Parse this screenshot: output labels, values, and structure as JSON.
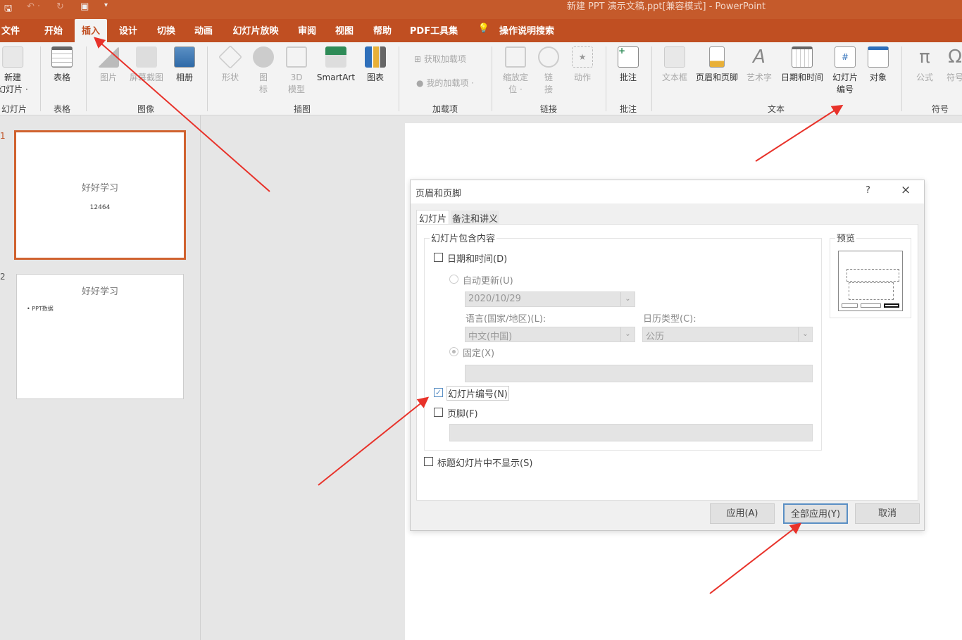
{
  "window": {
    "title": "新建 PPT 演示文稿.ppt[兼容模式]  -  PowerPoint"
  },
  "tabs": [
    "文件",
    "开始",
    "插入",
    "设计",
    "切换",
    "动画",
    "幻灯片放映",
    "审阅",
    "视图",
    "帮助",
    "PDF工具集"
  ],
  "active_tab": "插入",
  "search": "操作说明搜索",
  "ribbon": {
    "items": {
      "new_slide": "新建\n幻灯片 ·",
      "table": "表格",
      "picture": "图片",
      "screenshot": "屏幕截图",
      "album": "相册",
      "shapes": "形状",
      "icons": "图\n标",
      "model3d": "3D\n模型",
      "smartart": "SmartArt",
      "chart": "图表",
      "get_addins": "获取加载项",
      "my_addins": "我的加载项",
      "zoom": "缩放定\n位 ·",
      "link": "链\n接",
      "action": "动作",
      "comment": "批注",
      "textbox": "文本框",
      "header_footer": "页眉和页脚",
      "wordart": "艺术字",
      "datetime": "日期和时间",
      "slide_number": "幻灯片\n编号",
      "object": "对象",
      "equation": "公式",
      "symbol": "符号"
    },
    "groups": {
      "slides": "幻灯片",
      "tables": "表格",
      "images": "图像",
      "illustrations": "插图",
      "addins": "加载项",
      "links": "链接",
      "comments": "批注",
      "text": "文本",
      "symbols": "符号"
    }
  },
  "slides": [
    {
      "number": "1",
      "title": "好好学习",
      "body": "12464",
      "selected": true
    },
    {
      "number": "2",
      "title": "好好学习",
      "body": "• PPT数据",
      "selected": false
    }
  ],
  "dialog": {
    "title": "页眉和页脚",
    "help": "?",
    "close": "×",
    "tabs": [
      "幻灯片",
      "备注和讲义"
    ],
    "group_label": "幻灯片包含内容",
    "datetime": {
      "label": "日期和时间(D)",
      "checked": false
    },
    "auto_update": "自动更新(U)",
    "date_value": "2020/10/29",
    "language_label": "语言(国家/地区)(L):",
    "language_value": "中文(中国)",
    "calendar_label": "日历类型(C):",
    "calendar_value": "公历",
    "fixed": "固定(X)",
    "slide_number": {
      "label": "幻灯片编号(N)",
      "checked": true
    },
    "footer": {
      "label": "页脚(F)",
      "checked": false
    },
    "hide_title": {
      "label": "标题幻灯片中不显示(S)",
      "checked": false
    },
    "preview_label": "预览",
    "buttons": {
      "apply": "应用(A)",
      "apply_all": "全部应用(Y)",
      "cancel": "取消"
    }
  },
  "colors": {
    "accent": "#c04f22",
    "annotation_arrow": "#e8322a"
  }
}
